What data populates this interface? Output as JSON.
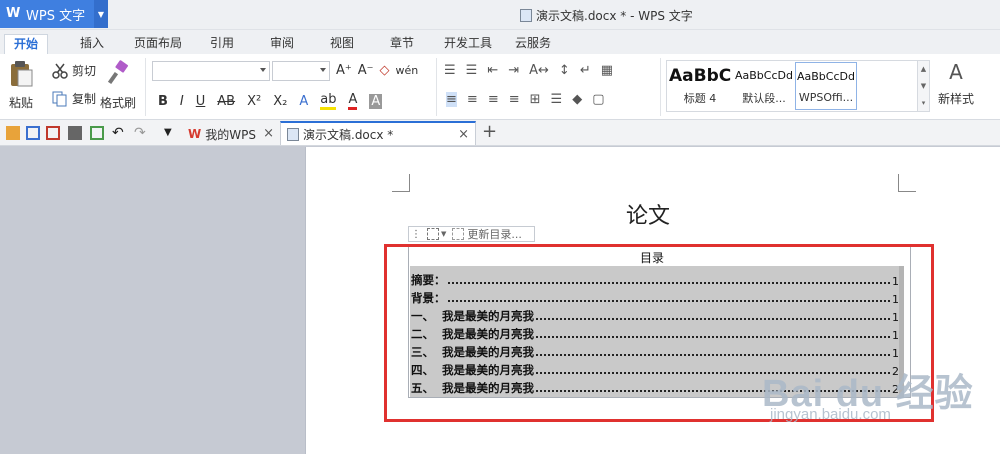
{
  "app": {
    "name": "WPS 文字",
    "window_title": "演示文稿.docx * - WPS 文字"
  },
  "ribbon_tabs": [
    "开始",
    "插入",
    "页面布局",
    "引用",
    "审阅",
    "视图",
    "章节",
    "开发工具",
    "云服务"
  ],
  "active_tab": "开始",
  "clipboard": {
    "paste": "粘贴",
    "cut": "剪切",
    "copy": "复制",
    "format_painter": "格式刷"
  },
  "styles": {
    "items": [
      {
        "sample": "AaBbC",
        "name": "标题 4"
      },
      {
        "sample": "AaBbCcDd",
        "name": "默认段..."
      },
      {
        "sample": "AaBbCcDd",
        "name": "WPSOffi..."
      }
    ],
    "new_style": "新样式"
  },
  "doc_tabs": [
    {
      "label": "我的WPS"
    },
    {
      "label": "演示文稿.docx *"
    }
  ],
  "document": {
    "heading": "论文",
    "toc_toolbar_label": "更新目录...",
    "toc_title": "目录",
    "toc_entries": [
      {
        "label": "摘要：",
        "page": "1"
      },
      {
        "label": "背景：",
        "page": "1"
      },
      {
        "label": "一、  我是最美的月亮我",
        "page": "1"
      },
      {
        "label": "二、  我是最美的月亮我",
        "page": "1"
      },
      {
        "label": "三、  我是最美的月亮我",
        "page": "1"
      },
      {
        "label": "四、  我是最美的月亮我",
        "page": "2"
      },
      {
        "label": "五、  我是最美的月亮我",
        "page": "2"
      }
    ]
  },
  "watermark": {
    "line1": "Bai du 经验",
    "line2": "jingyan.baidu.com"
  },
  "colors": {
    "accent": "#3f7fe0",
    "highlight_frame": "#e0312f"
  }
}
